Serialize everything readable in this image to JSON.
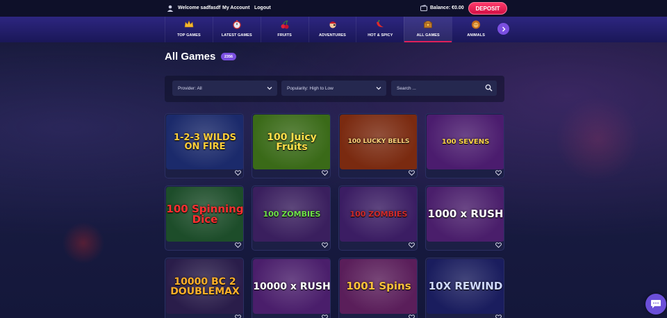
{
  "header": {
    "welcome": "Welcome sadfasdf",
    "my_account": "My Account",
    "logout": "Logout",
    "balance": "Balance: €0.00",
    "deposit": "DEPOSIT"
  },
  "categories": [
    {
      "label": "TOP GAMES",
      "icon": "crown-icon"
    },
    {
      "label": "LATEST GAMES",
      "icon": "stopwatch-icon"
    },
    {
      "label": "FRUITS",
      "icon": "cherry-icon"
    },
    {
      "label": "ADVENTURES",
      "icon": "pirate-icon"
    },
    {
      "label": "HOT & SPICY",
      "icon": "chili-icon"
    },
    {
      "label": "ALL GAMES",
      "icon": "treasure-chest-icon",
      "active": true
    },
    {
      "label": "ANIMALS",
      "icon": "lion-icon"
    }
  ],
  "main": {
    "title": "All Games",
    "count": "2356"
  },
  "filters": {
    "provider": "Provider: All",
    "sort": "Popularity: High to Low",
    "search_placeholder": "Search ..."
  },
  "games": [
    {
      "title": "1-2-3 WILDS ON FIRE",
      "bg": "#1b2a6b"
    },
    {
      "title": "100 Juicy Fruits",
      "bg": "#3a6a18"
    },
    {
      "title": "100 LUCKY BELLS",
      "bg": "#7a2a10"
    },
    {
      "title": "100 SEVENS",
      "bg": "#4b1c6e"
    },
    {
      "title": "100 Spinning Dice",
      "bg": "#1d4d2a"
    },
    {
      "title": "100 ZOMBIES",
      "bg": "#3a1f5e"
    },
    {
      "title": "100 ZOMBIES",
      "bg": "#3b1d63"
    },
    {
      "title": "1000 x RUSH",
      "bg": "#4a1e6b"
    },
    {
      "title": "10000 BC 2 DOUBLEMAX",
      "bg": "#2a1d4a"
    },
    {
      "title": "10000 x RUSH",
      "bg": "#4a1e6b"
    },
    {
      "title": "1001 Spins",
      "bg": "#5a1e5a"
    },
    {
      "title": "10X REWIND",
      "bg": "#1a1d5e"
    }
  ],
  "colors": {
    "accent": "#e0205a",
    "purple": "#7a4fe0"
  }
}
